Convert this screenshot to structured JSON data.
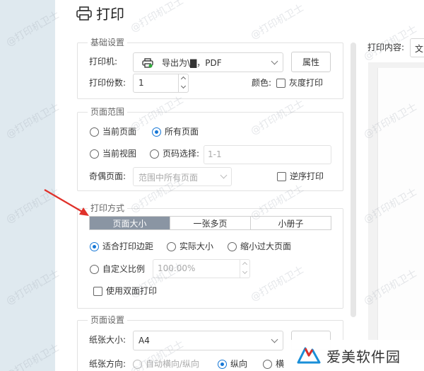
{
  "dialog": {
    "title": "打印",
    "title_icon": "printer-icon"
  },
  "basic": {
    "legend": "基础设置",
    "printer_label": "打印机:",
    "printer_value": "导出为\\▇，PDF",
    "printer_icon": "printer-small-icon",
    "properties_button": "属性",
    "copies_label": "打印份数:",
    "copies_value": "1",
    "color_label": "颜色:",
    "grayscale_label": "灰度打印"
  },
  "range": {
    "legend": "页面范围",
    "current_page": "当前页面",
    "all_pages": "所有页面",
    "current_view": "当前视图",
    "page_select": "页码选择:",
    "page_select_placeholder": "1-1",
    "odd_even_label": "奇偶页面:",
    "odd_even_value": "范围中所有页面",
    "reverse_label": "逆序打印"
  },
  "mode": {
    "legend": "打印方式",
    "tabs": [
      "页面大小",
      "一张多页",
      "小册子"
    ],
    "active_tab": "页面大小",
    "fit_margins": "适合打印边距",
    "actual_size": "实际大小",
    "shrink_oversize": "缩小过大页面",
    "custom_scale": "自定义比例",
    "custom_scale_value": "100.00%",
    "duplex_label": "使用双面打印"
  },
  "page_setup": {
    "legend": "页面设置",
    "paper_size_label": "纸张大小:",
    "paper_size_value": "A4",
    "orientation_label": "纸张方向:",
    "auto_orientation": "自动横向/纵向",
    "portrait": "纵向",
    "landscape_partial": "横"
  },
  "preview": {
    "content_label": "打印内容:",
    "content_value_partial": "文"
  },
  "watermark": {
    "text": "@打印机卫士"
  },
  "brand": {
    "name": "爱美软件园"
  },
  "colors": {
    "accent": "#1677d6",
    "active_tab": "#8a95a3",
    "arrow": "#e0312a"
  }
}
